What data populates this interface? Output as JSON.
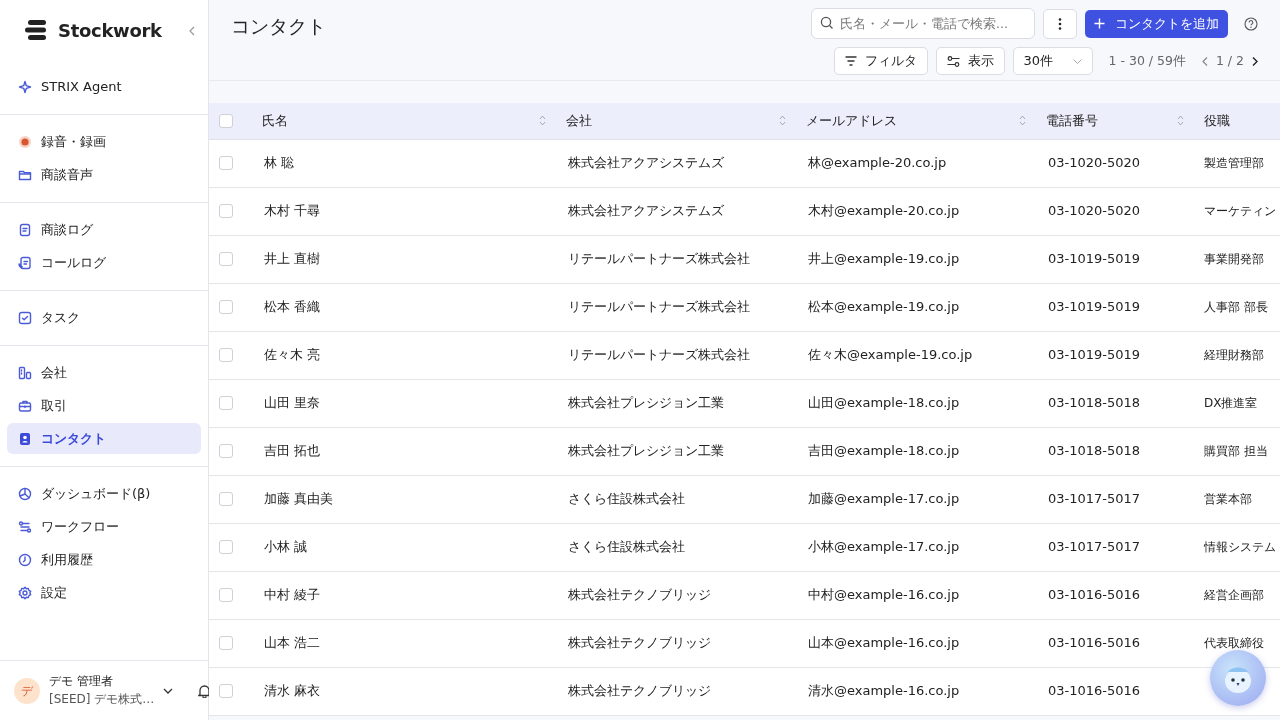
{
  "sidebar": {
    "logo": "Stockwork",
    "groups": [
      [
        {
          "label": "STRIX Agent",
          "selected": false
        }
      ],
      [
        {
          "label": "録音・録画",
          "selected": false
        },
        {
          "label": "商談音声",
          "selected": false
        }
      ],
      [
        {
          "label": "商談ログ",
          "selected": false
        },
        {
          "label": "コールログ",
          "selected": false
        }
      ],
      [
        {
          "label": "タスク",
          "selected": false
        }
      ],
      [
        {
          "label": "会社",
          "selected": false
        },
        {
          "label": "取引",
          "selected": false
        },
        {
          "label": "コンタクト",
          "selected": true
        }
      ],
      [
        {
          "label": "ダッシュボード(β)",
          "selected": false
        },
        {
          "label": "ワークフロー",
          "selected": false
        },
        {
          "label": "利用履歴",
          "selected": false
        },
        {
          "label": "設定",
          "selected": false
        }
      ]
    ],
    "user": {
      "avatar": "デ",
      "name": "デモ 管理者",
      "organization": "[SEED] デモ株式…"
    }
  },
  "header": {
    "title": "コンタクト",
    "search": {
      "placeholder": "氏名・メール・電話で検索..."
    },
    "add_button": "コンタクトを追加",
    "filter_button": "フィルタ",
    "view_button": "表示",
    "per_page": "30件",
    "range": "1 - 30 / 59件",
    "page": "1 / 2"
  },
  "table": {
    "all_checked": false,
    "columns": [
      "氏名",
      "会社",
      "メールアドレス",
      "電話番号",
      "役職"
    ],
    "rows": [
      {
        "checked": false,
        "cells": [
          "林 聡",
          "株式会社アクアシステムズ",
          "林@example-20.co.jp",
          "03-1020-5020",
          "製造管理部"
        ]
      },
      {
        "checked": false,
        "cells": [
          "木村 千尋",
          "株式会社アクアシステムズ",
          "木村@example-20.co.jp",
          "03-1020-5020",
          "マーケティン"
        ]
      },
      {
        "checked": false,
        "cells": [
          "井上 直樹",
          "リテールパートナーズ株式会社",
          "井上@example-19.co.jp",
          "03-1019-5019",
          "事業開発部"
        ]
      },
      {
        "checked": false,
        "cells": [
          "松本 香織",
          "リテールパートナーズ株式会社",
          "松本@example-19.co.jp",
          "03-1019-5019",
          "人事部 部長"
        ]
      },
      {
        "checked": false,
        "cells": [
          "佐々木 亮",
          "リテールパートナーズ株式会社",
          "佐々木@example-19.co.jp",
          "03-1019-5019",
          "経理財務部"
        ]
      },
      {
        "checked": false,
        "cells": [
          "山田 里奈",
          "株式会社プレシジョン工業",
          "山田@example-18.co.jp",
          "03-1018-5018",
          "DX推進室"
        ]
      },
      {
        "checked": false,
        "cells": [
          "吉田 拓也",
          "株式会社プレシジョン工業",
          "吉田@example-18.co.jp",
          "03-1018-5018",
          "購買部 担当"
        ]
      },
      {
        "checked": false,
        "cells": [
          "加藤 真由美",
          "さくら住設株式会社",
          "加藤@example-17.co.jp",
          "03-1017-5017",
          "営業本部"
        ]
      },
      {
        "checked": false,
        "cells": [
          "小林 誠",
          "さくら住設株式会社",
          "小林@example-17.co.jp",
          "03-1017-5017",
          "情報システム"
        ]
      },
      {
        "checked": false,
        "cells": [
          "中村 綾子",
          "株式会社テクノブリッジ",
          "中村@example-16.co.jp",
          "03-1016-5016",
          "経営企画部"
        ]
      },
      {
        "checked": false,
        "cells": [
          "山本 浩二",
          "株式会社テクノブリッジ",
          "山本@example-16.co.jp",
          "03-1016-5016",
          "代表取締役"
        ]
      },
      {
        "checked": false,
        "cells": [
          "清水 麻衣",
          "株式会社テクノブリッジ",
          "清水@example-16.co.jp",
          "03-1016-5016"
        ]
      }
    ]
  }
}
